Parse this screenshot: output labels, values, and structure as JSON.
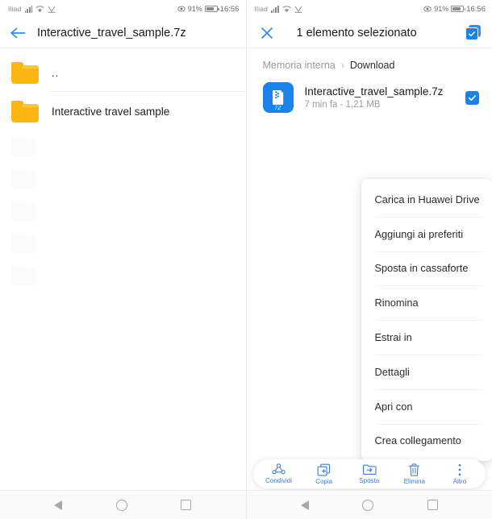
{
  "status_bar": {
    "carrier": "Iliad",
    "battery_percent": "91%",
    "time": "16:56",
    "icons": [
      "signal-bars-icon",
      "wifi-icon",
      "vpn-icon",
      "eye-care-icon",
      "battery-icon"
    ]
  },
  "left_panel": {
    "back_icon": "back-arrow-icon",
    "title": "Interactive_travel_sample.7z",
    "items": [
      {
        "label": "..",
        "icon": "folder-icon"
      },
      {
        "label": "Interactive travel sample",
        "icon": "folder-icon"
      }
    ],
    "ghost_rows": 5
  },
  "right_panel": {
    "close_icon": "close-icon",
    "selection_title": "1 elemento selezionato",
    "select_all_icon": "select-all-checkbox-icon",
    "breadcrumb": {
      "root": "Memoria interna",
      "separator": "›",
      "current": "Download"
    },
    "file": {
      "name": "Interactive_travel_sample.7z",
      "meta": "7 min fa - 1,21 MB",
      "icon": "archive-7z-icon",
      "extension_label": "7Z",
      "selected": true
    },
    "context_menu": [
      {
        "label": "Carica in Huawei Drive"
      },
      {
        "label": "Aggiungi ai preferiti"
      },
      {
        "label": "Sposta in cassaforte"
      },
      {
        "label": "Rinomina"
      },
      {
        "label": "Estrai in"
      },
      {
        "label": "Dettagli"
      },
      {
        "label": "Apri con"
      },
      {
        "label": "Crea collegamento"
      }
    ],
    "action_bar": [
      {
        "label": "Condividi",
        "icon": "share-icon"
      },
      {
        "label": "Copia",
        "icon": "copy-icon"
      },
      {
        "label": "Sposta",
        "icon": "move-folder-icon"
      },
      {
        "label": "Elimina",
        "icon": "trash-icon"
      },
      {
        "label": "Altro",
        "icon": "more-vertical-icon"
      }
    ]
  },
  "nav_bar": {
    "back": "nav-back-icon",
    "home": "nav-home-icon",
    "recents": "nav-recents-icon"
  },
  "colors": {
    "accent_blue": "#1a82e8",
    "toolbar_blue": "#3b7fd4",
    "folder_yellow": "#fbb614",
    "text_primary": "#1b1b1b",
    "text_secondary": "#9b9b9b"
  }
}
